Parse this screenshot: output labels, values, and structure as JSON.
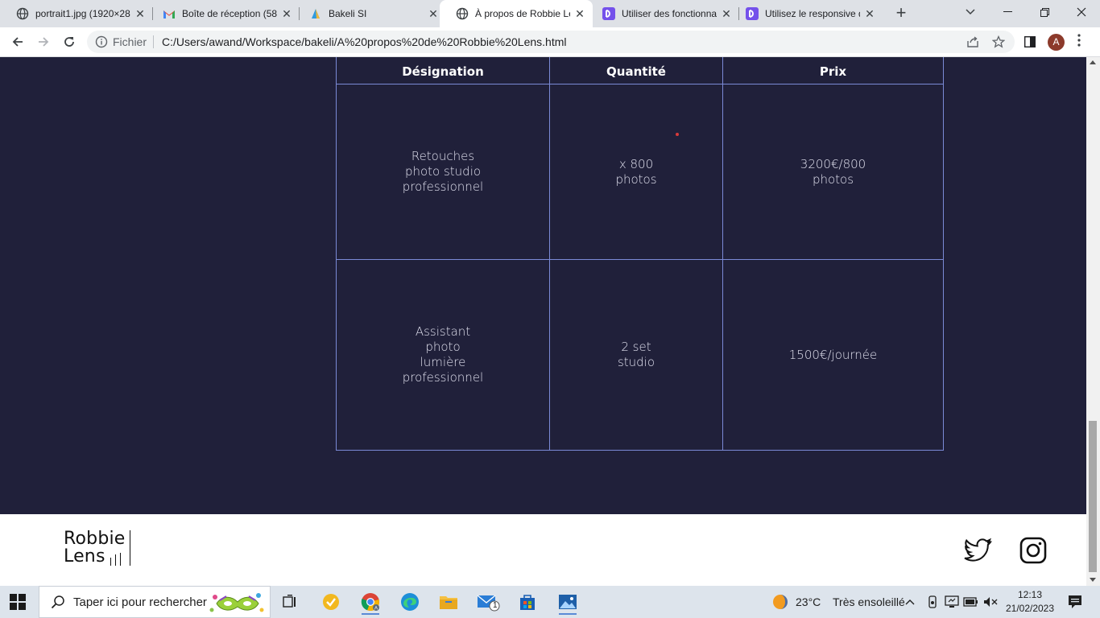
{
  "browser": {
    "tabs": [
      {
        "title": "portrait1.jpg (1920×28",
        "icon": "globe-icon",
        "close": "✕"
      },
      {
        "title": "Boîte de réception (58",
        "icon": "gmail-icon",
        "close": "✕"
      },
      {
        "title": "Bakeli SI",
        "icon": "bakeli-icon",
        "close": "✕"
      },
      {
        "title": "À propos de Robbie Le",
        "icon": "globe-icon",
        "close": "✕",
        "active": true
      },
      {
        "title": "Utiliser des fonctionna",
        "icon": "openclassrooms-icon",
        "close": "✕"
      },
      {
        "title": "Utilisez le responsive d",
        "icon": "openclassrooms-icon",
        "close": "✕"
      }
    ],
    "new_tab": "+",
    "omnibox": {
      "scheme_label": "Fichier",
      "url": "C:/Users/awand/Workspace/bakeli/A%20propos%20de%20Robbie%20Lens.html"
    },
    "profile_initial": "A"
  },
  "page": {
    "table": {
      "headers": [
        "Désignation",
        "Quantité",
        "Prix"
      ],
      "rows": [
        [
          [
            "Retouches",
            "photo studio",
            "professionnel"
          ],
          [
            "x 800",
            "photos"
          ],
          [
            "3200€/800",
            "photos"
          ]
        ],
        [
          [
            "Assistant",
            "photo",
            "lumière",
            "professionnel"
          ],
          [
            "2 set",
            "studio"
          ],
          [
            "1500€/journée"
          ]
        ]
      ]
    },
    "footer": {
      "logo_line1": "Robbie",
      "logo_line2": "Lens",
      "social": [
        "twitter-icon",
        "instagram-icon"
      ]
    }
  },
  "taskbar": {
    "search_placeholder": "Taper ici pour rechercher",
    "weather_temp": "23°C",
    "weather_desc": "Très ensoleillé",
    "time": "12:13",
    "date": "21/02/2023",
    "mail_badge": "1"
  },
  "colors": {
    "page_bg": "#20203a",
    "table_border": "#7b8ad6",
    "tabstrip_bg": "#dee1e6",
    "taskbar_bg": "#dde4ec"
  }
}
